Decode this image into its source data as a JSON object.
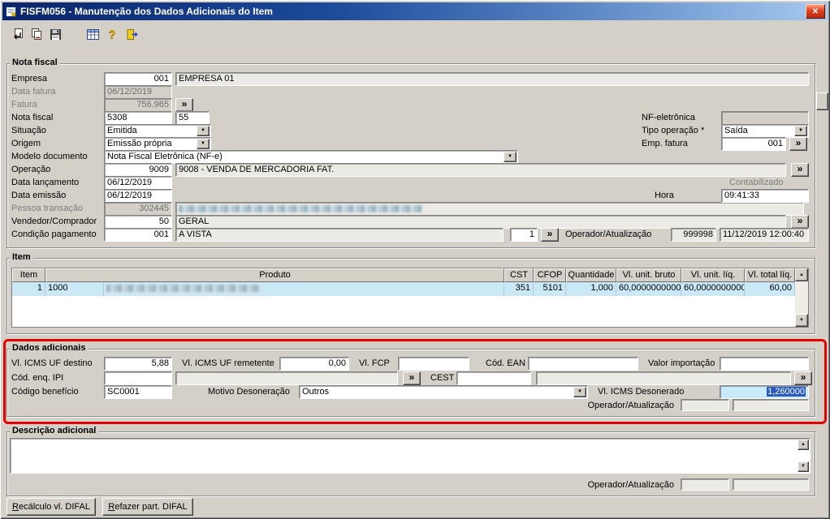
{
  "colors": {
    "window_bg": "#d4d0c8",
    "titlebar_left": "#0a246a",
    "titlebar_right": "#a6caf0",
    "close_button_red": "#d63a1c",
    "highlight_annotation_red": "#e60000",
    "selected_row_blue": "#cbe8f6",
    "selected_text_blue": "#2a5ac0",
    "selected_field_blue": "#c9eaf8"
  },
  "ui": {
    "close_glyph": "✕",
    "lookup_glyph": "»",
    "dropdown_arrow": "▼",
    "scroll_up": "▲",
    "scroll_down": "▼",
    "help_glyph": "?"
  },
  "window": {
    "title": "FISFM056 - Manutenção dos Dados Adicionais do Item"
  },
  "toolbar": {
    "icons": [
      "return-icon",
      "save-copy-icon",
      "save-icon",
      "table-icon",
      "help-icon",
      "exit-icon"
    ]
  },
  "nf": {
    "legend": "Nota fiscal",
    "empresa": {
      "label": "Empresa",
      "code": "001",
      "name": "EMPRESA 01"
    },
    "data_fatura": {
      "label": "Data fatura",
      "value": "06/12/2019"
    },
    "fatura": {
      "label": "Fatura",
      "value": "756.965"
    },
    "nota_fiscal": {
      "label": "Nota fiscal",
      "numero": "5308",
      "serie": "55"
    },
    "situacao": {
      "label": "Situação",
      "value": "Emitida"
    },
    "origem": {
      "label": "Origem",
      "value": "Emissão própria"
    },
    "modelo": {
      "label": "Modelo documento",
      "value": "Nota Fiscal Eletrônica (NF-e)"
    },
    "operacao": {
      "label": "Operação",
      "code": "9009",
      "desc": "9008 - VENDA DE MERCADORIA FAT."
    },
    "data_lancamento": {
      "label": "Data lançamento",
      "value": "06/12/2019"
    },
    "data_emissao": {
      "label": "Data emissão",
      "value": "06/12/2019"
    },
    "pessoa": {
      "label": "Pessoa transação",
      "code": "302445"
    },
    "vendedor": {
      "label": "Vendedor/Comprador",
      "code": "50",
      "desc": "GERAL"
    },
    "condicao": {
      "label": "Condição pagamento",
      "code": "001",
      "desc": "A VISTA",
      "parcela": "1"
    },
    "operador": {
      "label": "Operador/Atualização",
      "code": "999998",
      "datahora": "11/12/2019 12:00:40"
    },
    "nfe": {
      "label": "NF-eletrônica",
      "value": ""
    },
    "tipo_operacao": {
      "label": "Tipo operação *",
      "value": "Saída"
    },
    "emp_fatura": {
      "label": "Emp. fatura",
      "value": "001"
    },
    "contabilizado_label": "Contabilizado",
    "hora": {
      "label": "Hora",
      "value": "09:41:33"
    }
  },
  "item": {
    "legend": "Item",
    "headers": {
      "item": "Item",
      "produto": "Produto",
      "cst": "CST",
      "cfop": "CFOP",
      "quantidade": "Quantidade",
      "vl_unit_bruto": "Vl. unit. bruto",
      "vl_unit_liq": "Vl. unit. líq.",
      "vl_total_liq": "Vl. total líq."
    },
    "rows": [
      {
        "item": "1",
        "codigo": "1000",
        "cst": "351",
        "cfop": "5101",
        "quantidade": "1,000",
        "vl_unit_bruto": "60,0000000000",
        "vl_unit_liq": "60,0000000000",
        "vl_total_liq": "60,00"
      }
    ]
  },
  "dados": {
    "legend": "Dados adicionais",
    "icms_destino": {
      "label": "Vl. ICMS UF destino",
      "value": "5,88"
    },
    "icms_remetente": {
      "label": "Vl. ICMS UF remetente",
      "value": "0,00"
    },
    "fcp": {
      "label": "Vl. FCP",
      "value": ""
    },
    "ean": {
      "label": "Cód. EAN",
      "value": ""
    },
    "valor_importacao": {
      "label": "Valor importação",
      "value": ""
    },
    "cod_enq_ipi": {
      "label": "Cód. enq. IPI",
      "value": ""
    },
    "cest": {
      "label": "CEST",
      "value": ""
    },
    "codigo_beneficio": {
      "label": "Código benefício",
      "value": "SC0001"
    },
    "motivo_desoneracao": {
      "label": "Motivo Desoneração",
      "value": "Outros"
    },
    "icms_desonerado": {
      "label": "Vl. ICMS Desonerado",
      "value": "1,260000"
    },
    "operador_label": "Operador/Atualização"
  },
  "descricao": {
    "legend": "Descrição adicional",
    "text": "",
    "operador_label": "Operador/Atualização"
  },
  "footer": {
    "recalculo": "Recálculo vl. DIFAL",
    "refazer": "Refazer part. DIFAL"
  }
}
